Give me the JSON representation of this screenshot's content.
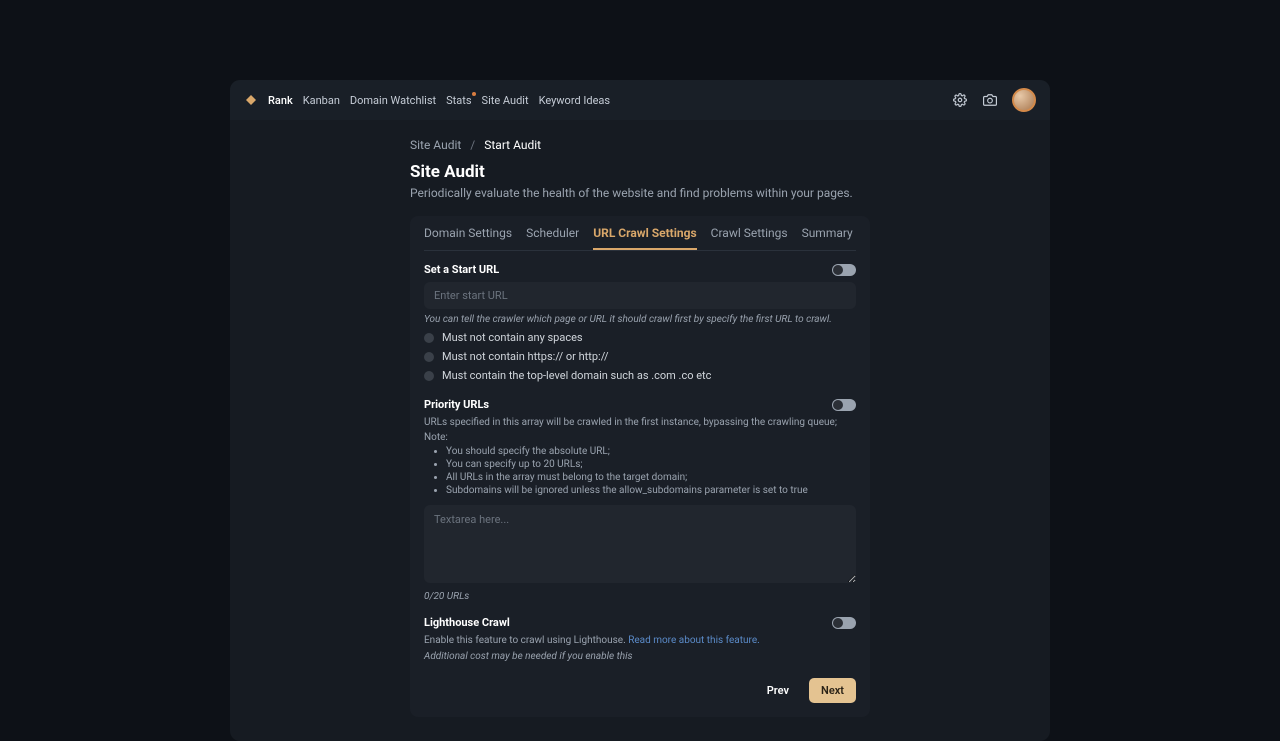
{
  "nav": {
    "items": [
      "Rank",
      "Kanban",
      "Domain Watchlist",
      "Stats",
      "Site Audit",
      "Keyword Ideas"
    ],
    "active_index": 0,
    "stats_has_dot": true
  },
  "breadcrumb": {
    "parent": "Site Audit",
    "current": "Start Audit"
  },
  "page": {
    "title": "Site Audit",
    "subtitle": "Periodically evaluate the health of the website and find problems within your pages."
  },
  "tabs": {
    "items": [
      "Domain Settings",
      "Scheduler",
      "URL Crawl Settings",
      "Crawl Settings",
      "Summary"
    ],
    "active_index": 2
  },
  "start_url": {
    "label": "Set a Start URL",
    "placeholder": "Enter start URL",
    "hint": "You can tell the crawler which page or URL it should crawl first by specify the first URL to crawl.",
    "rules": [
      "Must not contain any spaces",
      "Must not contain https:// or http://",
      "Must contain the top-level domain such as .com .co etc"
    ]
  },
  "priority": {
    "label": "Priority URLs",
    "desc": "URLs specified in this array will be crawled in the first instance, bypassing the crawling queue;",
    "note_label": "Note:",
    "notes": [
      "You should specify the absolute URL;",
      "You can specify up to 20 URLs;",
      "All URLs in the array must belong to the target domain;",
      "Subdomains will be ignored unless the allow_subdomains parameter is set to true"
    ],
    "textarea_placeholder": "Textarea here...",
    "counter": "0/20 URLs"
  },
  "lighthouse": {
    "label": "Lighthouse Crawl",
    "desc_prefix": "Enable this feature to crawl using Lighthouse. ",
    "link": "Read more about this feature.",
    "hint": "Additional cost may be needed if you enable this"
  },
  "buttons": {
    "prev": "Prev",
    "next": "Next"
  }
}
